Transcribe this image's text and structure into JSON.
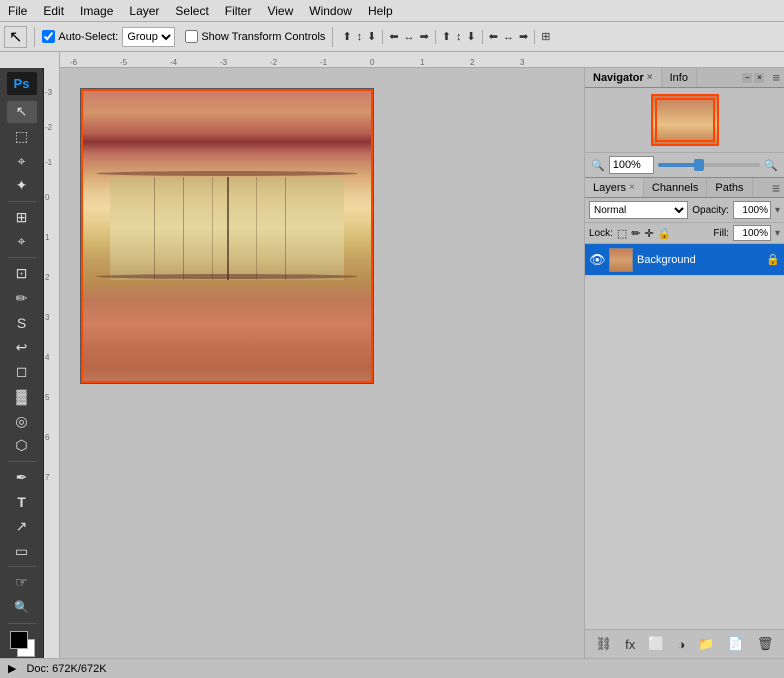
{
  "menubar": {
    "items": [
      "File",
      "Edit",
      "Image",
      "Layer",
      "Select",
      "Filter",
      "View",
      "Window",
      "Help"
    ]
  },
  "toolbar": {
    "auto_select_label": "Auto-Select:",
    "auto_select_value": "Group",
    "show_transform_label": "Show Transform Controls",
    "align_icons": [
      "⊞",
      "⊟",
      "⊠",
      "⊡",
      "⊢",
      "⊣",
      "⊤",
      "⊥",
      "⊦",
      "⊧",
      "⊨",
      "⊩"
    ],
    "transform_label": "Show Transform Controls"
  },
  "navigator": {
    "tab_label": "Navigator",
    "info_tab_label": "Info",
    "zoom_value": "100%"
  },
  "layers": {
    "tab_label": "Layers",
    "channels_tab": "Channels",
    "paths_tab": "Paths",
    "blend_mode": "Normal",
    "opacity_label": "Opacity:",
    "opacity_value": "100%",
    "lock_label": "Lock:",
    "fill_label": "Fill:",
    "fill_value": "100%",
    "layer_items": [
      {
        "name": "Background",
        "visible": true,
        "locked": true,
        "selected": true
      }
    ]
  },
  "canvas": {
    "zoom": "100%"
  },
  "statusbar": {
    "doc_info": "Doc: 672K/672K"
  },
  "colors": {
    "active_tab_bg": "#c0c0c0",
    "inactive_tab_bg": "#b0b0b0",
    "selected_layer_bg": "#1166cc",
    "ps_blue": "#2196F3",
    "toolbar_bg": "#dddddd",
    "panel_bg": "#c0c0c0"
  },
  "tools": {
    "items": [
      {
        "icon": "↖",
        "name": "move-tool"
      },
      {
        "icon": "⬚",
        "name": "marquee-tool"
      },
      {
        "icon": "⌖",
        "name": "lasso-tool"
      },
      {
        "icon": "✦",
        "name": "magic-wand-tool"
      },
      {
        "icon": "✂",
        "name": "crop-tool"
      },
      {
        "icon": "⊡",
        "name": "eyedropper-tool"
      },
      {
        "icon": "⌫",
        "name": "healing-tool"
      },
      {
        "icon": "✏",
        "name": "brush-tool"
      },
      {
        "icon": "S",
        "name": "stamp-tool"
      },
      {
        "icon": "◈",
        "name": "history-tool"
      },
      {
        "icon": "◉",
        "name": "eraser-tool"
      },
      {
        "icon": "▓",
        "name": "gradient-tool"
      },
      {
        "icon": "◎",
        "name": "blur-tool"
      },
      {
        "icon": "⬡",
        "name": "dodge-tool"
      },
      {
        "icon": "✒",
        "name": "pen-tool"
      },
      {
        "icon": "T",
        "name": "type-tool"
      },
      {
        "icon": "↗",
        "name": "path-selection-tool"
      },
      {
        "icon": "▭",
        "name": "shape-tool"
      },
      {
        "icon": "☞",
        "name": "hand-tool"
      },
      {
        "icon": "🔍",
        "name": "zoom-tool"
      }
    ]
  }
}
